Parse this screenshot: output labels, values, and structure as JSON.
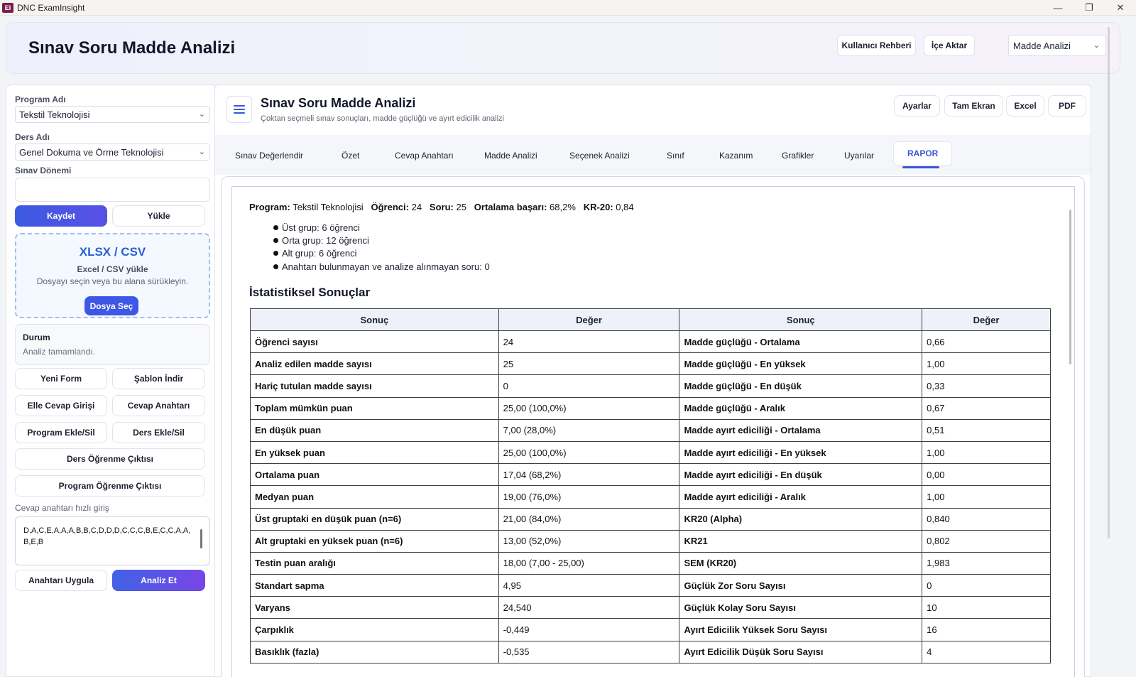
{
  "window": {
    "icon_text": "EI",
    "title": "DNC ExamInsight",
    "minimize": "—",
    "restore": "❐",
    "close": "✕"
  },
  "header": {
    "title": "Sınav Soru Madde Analizi",
    "guide_btn": "Kullanıcı Rehberi",
    "import_btn": "İçe Aktar",
    "mode_select": "Madde Analizi"
  },
  "sidebar": {
    "program_label": "Program Adı",
    "program_value": "Tekstil Teknolojisi",
    "course_label": "Ders Adı",
    "course_value": "Genel Dokuma ve Örme Teknolojisi",
    "term_label": "Sınav Dönemi",
    "term_value": "",
    "save_btn": "Kaydet",
    "load_btn": "Yükle",
    "drop_title": "XLSX / CSV",
    "drop_sub": "Excel / CSV yükle",
    "drop_hint": "Dosyayı seçin veya bu alana sürükleyin.",
    "drop_btn": "Dosya Seç",
    "status_title": "Durum",
    "status_value": "Analiz tamamlandı.",
    "new_form_btn": "Yeni Form",
    "template_btn": "Şablon İndir",
    "manual_entry_btn": "Elle Cevap Girişi",
    "answer_key_btn": "Cevap Anahtarı",
    "program_edit_btn": "Program Ekle/Sil",
    "course_edit_btn": "Ders Ekle/Sil",
    "course_outcome_btn": "Ders Öğrenme Çıktısı",
    "program_outcome_btn": "Program Öğrenme Çıktısı",
    "quick_key_label": "Cevap anahtarı hızlı giriş",
    "quick_key_value": "D,A,C,E,A,A,A,B,B,C,D,D,D,C,C,C,B,E,C,C,A,A,B,E,B",
    "apply_key_btn": "Anahtarı Uygula",
    "analyze_btn": "Analiz Et"
  },
  "main": {
    "title": "Sınav Soru Madde Analizi",
    "subtitle": "Çoktan seçmeli sınav sonuçları, madde güçlüğü ve ayırt edicilik analizi",
    "settings_btn": "Ayarlar",
    "fullscreen_btn": "Tam Ekran",
    "excel_btn": "Excel",
    "pdf_btn": "PDF",
    "tabs": [
      "Sınav Değerlendir",
      "Özet",
      "Cevap Anahtarı",
      "Madde Analizi",
      "Seçenek Analizi",
      "Sınıf",
      "Kazanım",
      "Grafikler",
      "Uyarılar",
      "RAPOR"
    ],
    "active_tab": "RAPOR"
  },
  "report": {
    "program_label": "Program:",
    "program_value": "Tekstil Teknolojisi",
    "student_label": "Öğrenci:",
    "student_value": "24",
    "question_label": "Soru:",
    "question_value": "25",
    "avg_label": "Ortalama başarı:",
    "avg_value": "68,2%",
    "kr20_label": "KR-20:",
    "kr20_value": "0,84",
    "bullets": [
      "Üst grup: 6 öğrenci",
      "Orta grup: 12 öğrenci",
      "Alt grup: 6 öğrenci",
      "Anahtarı bulunmayan ve analize alınmayan soru: 0"
    ],
    "stats_heading": "İstatistiksel Sonuçlar",
    "table_headers": [
      "Sonuç",
      "Değer",
      "Sonuç",
      "Değer"
    ],
    "rows": [
      [
        "Öğrenci sayısı",
        "24",
        "Madde güçlüğü - Ortalama",
        "0,66"
      ],
      [
        "Analiz edilen madde sayısı",
        "25",
        "Madde güçlüğü - En yüksek",
        "1,00"
      ],
      [
        "Hariç tutulan madde sayısı",
        "0",
        "Madde güçlüğü - En düşük",
        "0,33"
      ],
      [
        "Toplam mümkün puan",
        "25,00 (100,0%)",
        "Madde güçlüğü - Aralık",
        "0,67"
      ],
      [
        "En düşük puan",
        "7,00 (28,0%)",
        "Madde ayırt ediciliği - Ortalama",
        "0,51"
      ],
      [
        "En yüksek puan",
        "25,00 (100,0%)",
        "Madde ayırt ediciliği - En yüksek",
        "1,00"
      ],
      [
        "Ortalama puan",
        "17,04 (68,2%)",
        "Madde ayırt ediciliği - En düşük",
        "0,00"
      ],
      [
        "Medyan puan",
        "19,00 (76,0%)",
        "Madde ayırt ediciliği - Aralık",
        "1,00"
      ],
      [
        "Üst gruptaki en düşük puan (n=6)",
        "21,00 (84,0%)",
        "KR20 (Alpha)",
        "0,840"
      ],
      [
        "Alt gruptaki en yüksek puan (n=6)",
        "13,00 (52,0%)",
        "KR21",
        "0,802"
      ],
      [
        "Testin puan aralığı",
        "18,00 (7,00 - 25,00)",
        "SEM (KR20)",
        "1,983"
      ],
      [
        "Standart sapma",
        "4,95",
        "Güçlük Zor Soru Sayısı",
        "0"
      ],
      [
        "Varyans",
        "24,540",
        "Güçlük Kolay Soru Sayısı",
        "10"
      ],
      [
        "Çarpıklık",
        "-0,449",
        "Ayırt Edicilik Yüksek Soru Sayısı",
        "16"
      ],
      [
        "Basıklık (fazla)",
        "-0,535",
        "Ayırt Edicilik Düşük Soru Sayısı",
        "4"
      ]
    ]
  }
}
